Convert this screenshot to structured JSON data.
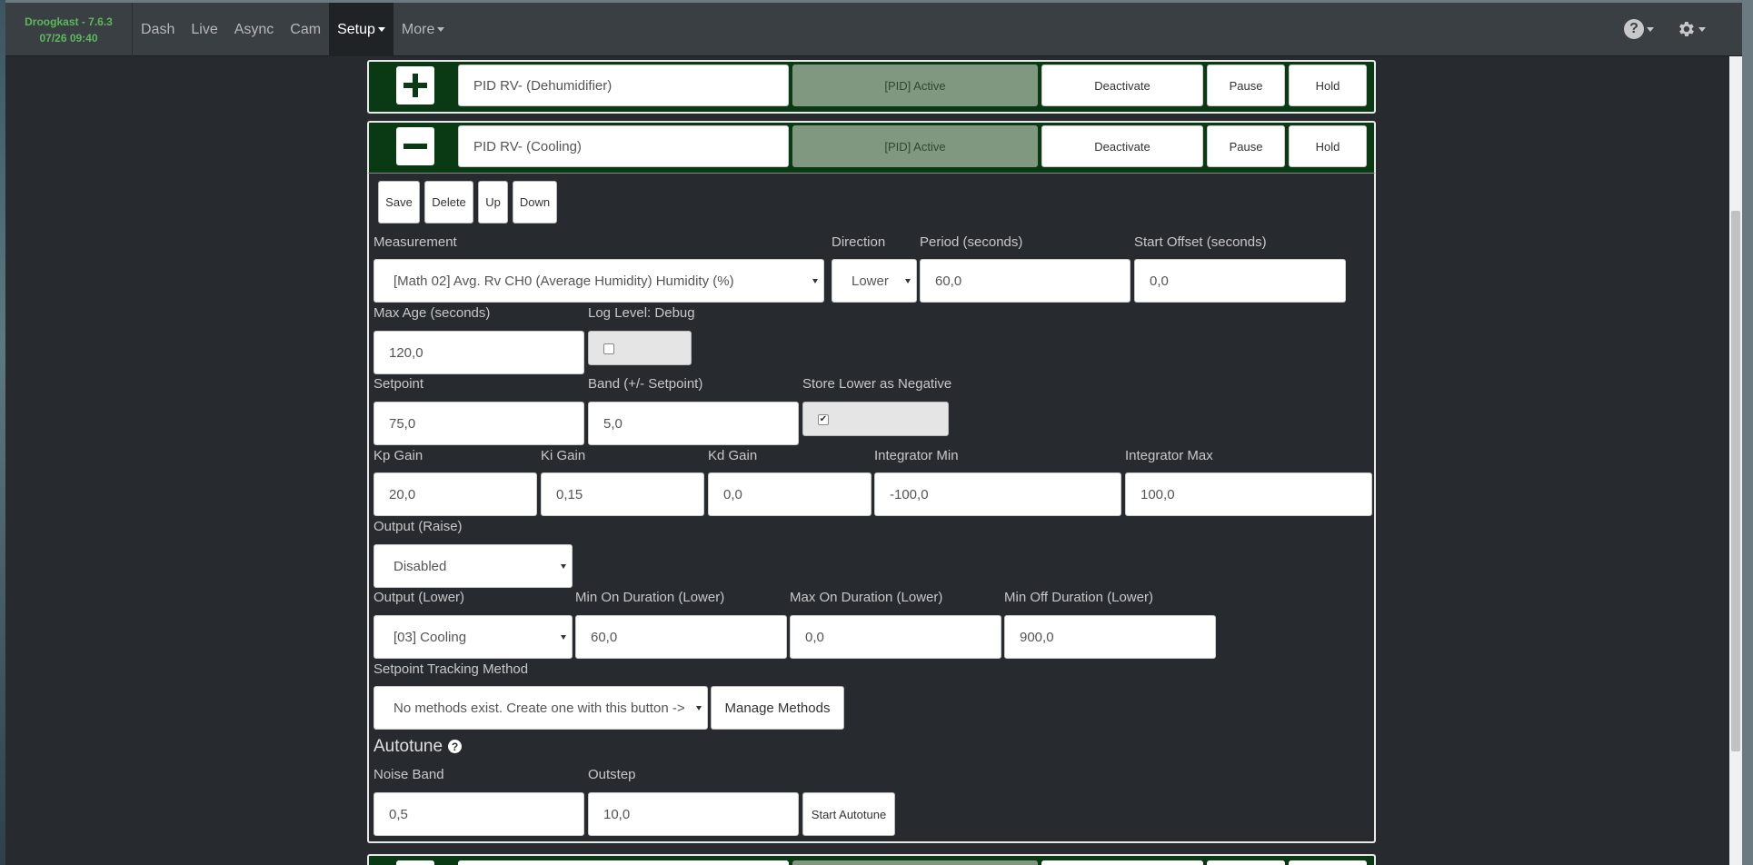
{
  "brand": {
    "name": "Droogkast - 7.6.3",
    "datetime": "07/26 09:40"
  },
  "nav": [
    {
      "label": "Dash",
      "active": false,
      "dropdown": false
    },
    {
      "label": "Live",
      "active": false,
      "dropdown": false
    },
    {
      "label": "Async",
      "active": false,
      "dropdown": false
    },
    {
      "label": "Cam",
      "active": false,
      "dropdown": false
    },
    {
      "label": "Setup",
      "active": true,
      "dropdown": true
    },
    {
      "label": "More",
      "active": false,
      "dropdown": true
    }
  ],
  "nav_right": {
    "help_icon": "question-circle-icon",
    "settings_icon": "gear-icon"
  },
  "pid_dehumidifier": {
    "toggle_icon": "plus-icon",
    "name": "PID RV- (Dehumidifier)",
    "status": "[PID] Active",
    "deactivate": "Deactivate",
    "pause": "Pause",
    "hold": "Hold"
  },
  "pid_cooling": {
    "toggle_icon": "minus-icon",
    "name": "PID RV- (Cooling)",
    "status": "[PID] Active",
    "deactivate": "Deactivate",
    "pause": "Pause",
    "hold": "Hold"
  },
  "actions": {
    "save": "Save",
    "delete": "Delete",
    "up": "Up",
    "down": "Down"
  },
  "form": {
    "measurement": {
      "label": "Measurement",
      "value": "[Math 02] Avg. Rv CH0 (Average Humidity) Humidity (%)"
    },
    "direction": {
      "label": "Direction",
      "value": "Lower"
    },
    "period": {
      "label": "Period (seconds)",
      "value": "60,0"
    },
    "start_offset": {
      "label": "Start Offset (seconds)",
      "value": "0,0"
    },
    "max_age": {
      "label": "Max Age (seconds)",
      "value": "120,0"
    },
    "log_level": {
      "label": "Log Level: Debug",
      "checked": false
    },
    "setpoint": {
      "label": "Setpoint",
      "value": "75,0"
    },
    "band": {
      "label": "Band (+/- Setpoint)",
      "value": "5,0"
    },
    "store_lower": {
      "label": "Store Lower as Negative",
      "checked": true
    },
    "kp": {
      "label": "Kp Gain",
      "value": "20,0"
    },
    "ki": {
      "label": "Ki Gain",
      "value": "0,15"
    },
    "kd": {
      "label": "Kd Gain",
      "value": "0,0"
    },
    "integrator_min": {
      "label": "Integrator Min",
      "value": "-100,0"
    },
    "integrator_max": {
      "label": "Integrator Max",
      "value": "100,0"
    },
    "output_raise": {
      "label": "Output (Raise)",
      "value": "Disabled"
    },
    "output_lower": {
      "label": "Output (Lower)",
      "value": "[03] Cooling"
    },
    "min_on_lower": {
      "label": "Min On Duration (Lower)",
      "value": "60,0"
    },
    "max_on_lower": {
      "label": "Max On Duration (Lower)",
      "value": "0,0"
    },
    "min_off_lower": {
      "label": "Min Off Duration (Lower)",
      "value": "900,0"
    },
    "tracking": {
      "label": "Setpoint Tracking Method",
      "value": "No methods exist. Create one with this button ->"
    },
    "manage_methods": "Manage Methods"
  },
  "autotune": {
    "title": "Autotune",
    "help_icon": "question-circle-icon",
    "noise_band": {
      "label": "Noise Band",
      "value": "0,5"
    },
    "outstep": {
      "label": "Outstep",
      "value": "10,0"
    },
    "start": "Start Autotune"
  }
}
